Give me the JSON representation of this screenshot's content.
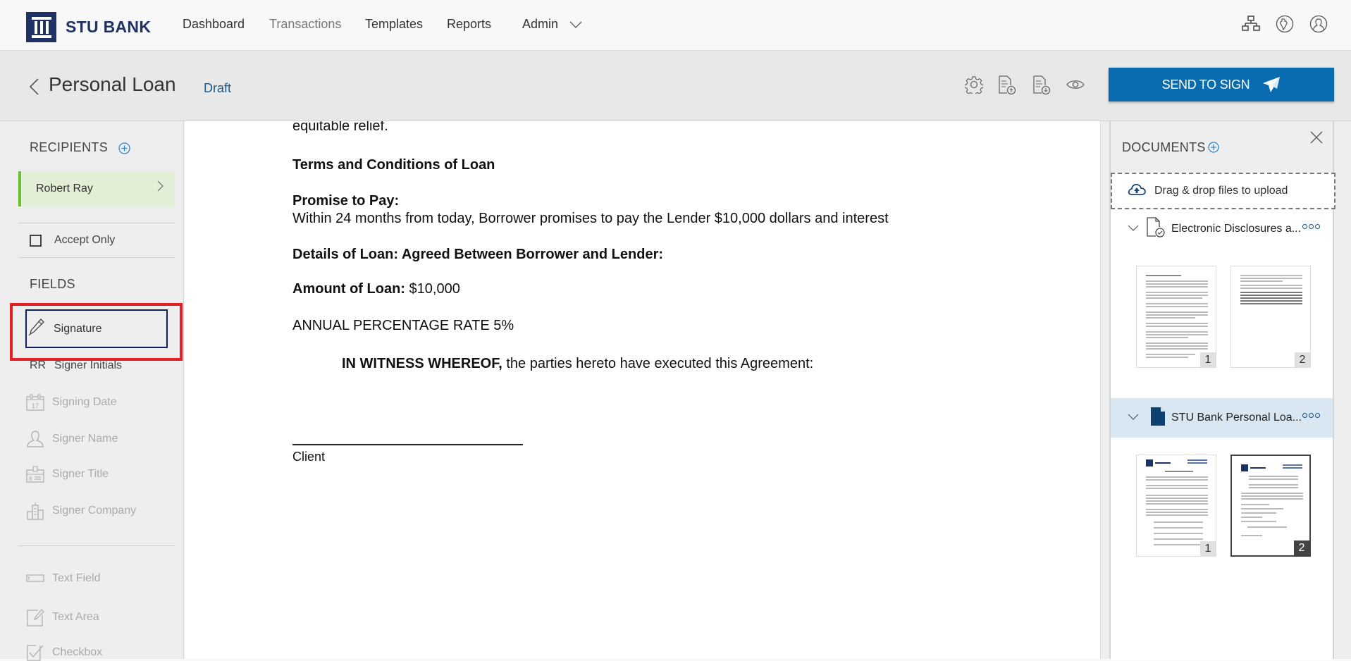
{
  "app": {
    "brand": "STU BANK",
    "brand_color": "#1e3264",
    "accent_color": "#0a6cb0"
  },
  "nav": {
    "items": [
      {
        "label": "Dashboard"
      },
      {
        "label": "Transactions"
      },
      {
        "label": "Templates"
      },
      {
        "label": "Reports"
      },
      {
        "label": "Admin"
      }
    ],
    "right_icons": [
      "org-chart-icon",
      "globe-icon",
      "user-icon"
    ]
  },
  "header": {
    "title": "Personal Loan",
    "status": "Draft",
    "icons": [
      "settings-icon",
      "upload-document-icon",
      "download-document-icon",
      "preview-icon"
    ],
    "send_label": "SEND TO SIGN"
  },
  "sidebar": {
    "recipients_title": "RECIPIENTS",
    "recipient": "Robert Ray",
    "accept_only_label": "Accept Only",
    "accept_only_checked": false,
    "fields_title": "FIELDS",
    "signature_label": "Signature",
    "initials_abbrev": "RR",
    "fields": [
      {
        "label": "Signer Initials",
        "enabled": true
      },
      {
        "label": "Signing Date",
        "enabled": false
      },
      {
        "label": "Signer Name",
        "enabled": false
      },
      {
        "label": "Signer Title",
        "enabled": false
      },
      {
        "label": "Signer Company",
        "enabled": false
      }
    ],
    "extra_fields": [
      {
        "label": "Text Field"
      },
      {
        "label": "Text Area"
      },
      {
        "label": "Checkbox"
      }
    ]
  },
  "document": {
    "lines": {
      "relief": "equitable relief.",
      "terms": "Terms and Conditions of Loan",
      "promise_heading": "Promise to Pay:",
      "promise_text": "Within 24 months from today, Borrower promises to pay the Lender $10,000 dollars and interest",
      "details": "Details of Loan: Agreed Between Borrower and Lender:",
      "amount_label": "Amount of Loan:",
      "amount_value": "$10,000",
      "apr": "ANNUAL PERCENTAGE RATE 5%",
      "witness_bold": "IN WITNESS WHEREOF,",
      "witness_rest": " the parties hereto have executed this Agreement:",
      "client": "Client"
    }
  },
  "documents_panel": {
    "title": "DOCUMENTS",
    "dropzone": "Drag & drop files to upload",
    "docs": [
      {
        "name": "Electronic Disclosures a...",
        "selected": false,
        "pages": [
          "1",
          "2"
        ]
      },
      {
        "name": "STU Bank Personal Loa...",
        "selected": true,
        "pages": [
          "1",
          "2"
        ],
        "active_page": "2"
      }
    ]
  }
}
